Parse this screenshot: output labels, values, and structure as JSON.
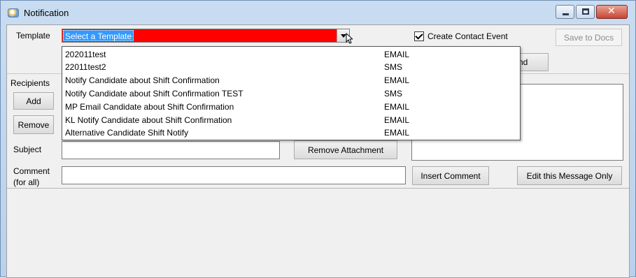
{
  "window": {
    "title": "Notification",
    "icon": "notification-app-icon",
    "controls": [
      "minimize",
      "maximize",
      "close"
    ]
  },
  "template": {
    "label": "Template",
    "selected": "Select a Template",
    "options": [
      {
        "name": "202011test",
        "type": "EMAIL"
      },
      {
        "name": "22011test2",
        "type": "SMS"
      },
      {
        "name": "Notify Candidate about Shift Confirmation",
        "type": "EMAIL"
      },
      {
        "name": "Notify Candidate about Shift Confirmation TEST",
        "type": "SMS"
      },
      {
        "name": "MP Email Candidate about Shift Confirmation",
        "type": "EMAIL"
      },
      {
        "name": "KL Notify Candidate about Shift Confirmation",
        "type": "EMAIL"
      },
      {
        "name": "Alternative Candidate Shift Notify",
        "type": "EMAIL"
      }
    ]
  },
  "create_contact_event": {
    "label": "Create Contact Event",
    "checked": true
  },
  "buttons": {
    "save_to_docs": "Save to Docs",
    "send_partial": "nd",
    "add": "Add",
    "remove": "Remove",
    "remove_attachment": "Remove Attachment",
    "insert_comment": "Insert Comment",
    "edit_this_message_only": "Edit this Message Only"
  },
  "recipients": {
    "label": "Recipients"
  },
  "subject": {
    "label": "Subject",
    "value": ""
  },
  "comment": {
    "label_line1": "Comment",
    "label_line2": "(for all)",
    "value": ""
  }
}
